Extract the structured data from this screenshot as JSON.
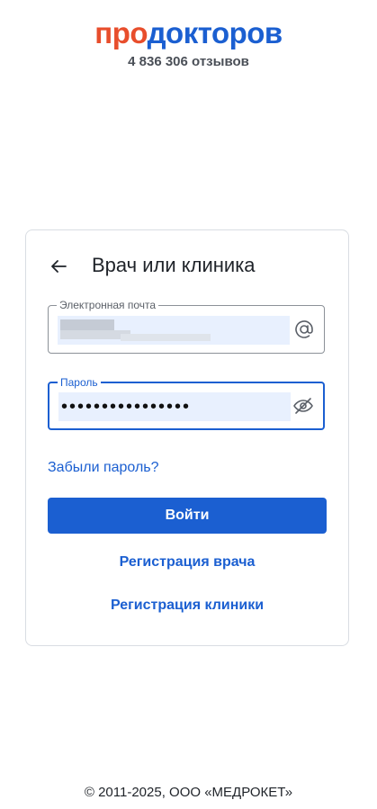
{
  "brand": {
    "part1": "про",
    "part2": "докторов",
    "reviews": "4 836 306 отзывов"
  },
  "card": {
    "title": "Врач или клиника"
  },
  "email": {
    "label": "Электронная почта",
    "value": ""
  },
  "password": {
    "label": "Пароль",
    "value": "••••••••••••••••"
  },
  "links": {
    "forgot": "Забыли пароль?",
    "register_doctor": "Регистрация врача",
    "register_clinic": "Регистрация клиники"
  },
  "submit": {
    "label": "Войти"
  },
  "footer": {
    "copyright": "© 2011-2025, ООО «МЕДРОКЕТ»"
  },
  "colors": {
    "brand_red": "#e84e2c",
    "brand_blue": "#1b5fd1",
    "autofill": "#e8f0fe"
  },
  "icons": {
    "back": "arrow-left-icon",
    "email": "at-sign-icon",
    "password": "eye-off-icon"
  }
}
